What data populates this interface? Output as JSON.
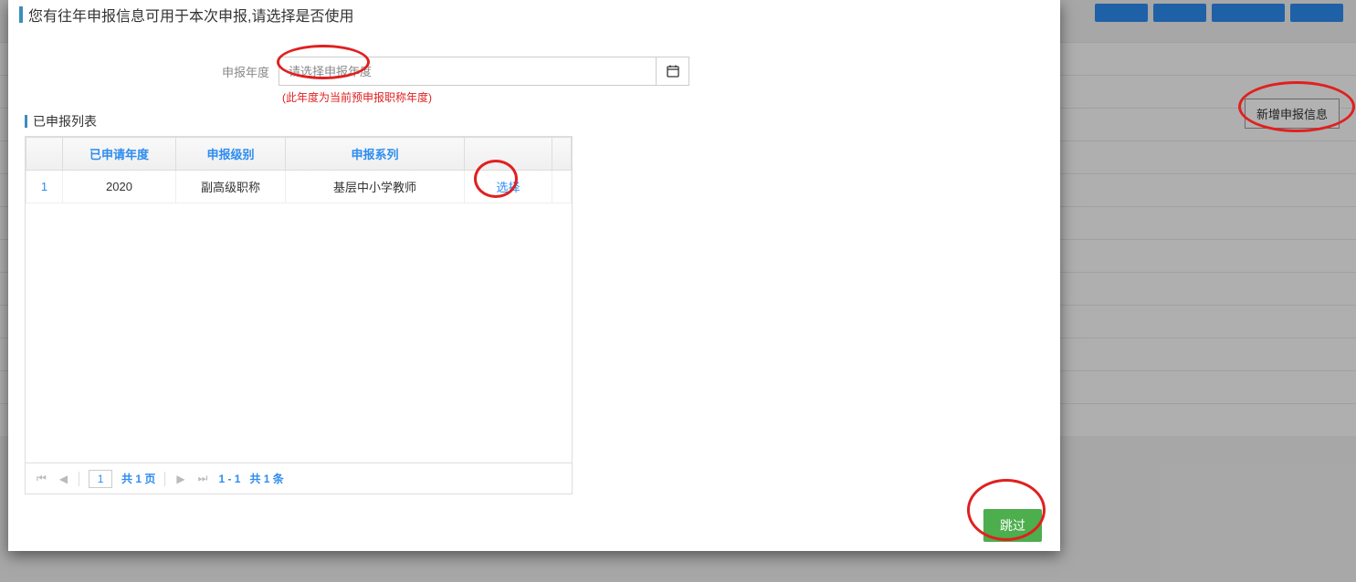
{
  "modal": {
    "title": "您有往年申报信息可用于本次申报,请选择是否使用",
    "form": {
      "year_label": "申报年度",
      "year_placeholder": "请选择申报年度",
      "year_hint": "(此年度为当前预申报职称年度)"
    },
    "section_title": "已申报列表",
    "table": {
      "columns": [
        "已申请年度",
        "申报级别",
        "申报系列"
      ],
      "rows": [
        {
          "idx": "1",
          "year": "2020",
          "level": "副高级职称",
          "series": "基层中小学教师",
          "action": "选择"
        }
      ]
    },
    "pager": {
      "page": "1",
      "total_pages_text": "共 1 页",
      "range_text": "1 - 1",
      "total_records_text": "共 1 条"
    },
    "footer": {
      "skip": "跳过"
    }
  },
  "background": {
    "add_button": "新增申报信息"
  }
}
